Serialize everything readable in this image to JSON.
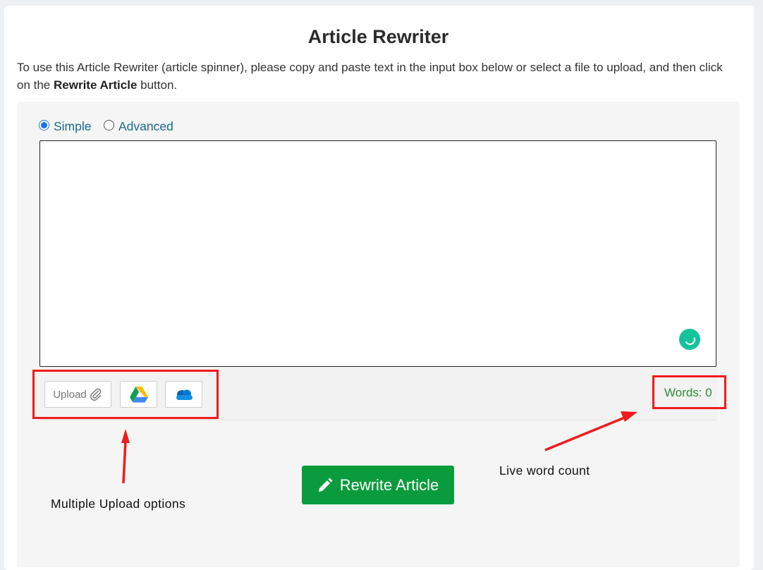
{
  "page": {
    "title": "Article Rewriter",
    "intro_before": "To use this Article Rewriter (article spinner), please copy and paste text in the input box below or select a file to upload, and then click on the ",
    "intro_bold": "Rewrite Article",
    "intro_after": " button."
  },
  "mode": {
    "options": [
      "Simple",
      "Advanced"
    ],
    "selected": "Simple"
  },
  "editor": {
    "value": "",
    "placeholder": ""
  },
  "upload": {
    "label": "Upload",
    "icons": [
      "paperclip-icon",
      "google-drive-icon",
      "onedrive-icon"
    ]
  },
  "word_count": {
    "text": "Words: 0"
  },
  "action": {
    "button_label": "Rewrite Article",
    "icon": "pencil-icon"
  },
  "annotations": {
    "upload_note": "Multiple Upload options",
    "count_note": "Live word count",
    "color": "#ee1c1c"
  },
  "colors": {
    "primary_button": "#0a9c3c",
    "link_text": "#186c8f",
    "word_count": "#2e8b3a",
    "grammar_badge": "#15c39a"
  }
}
